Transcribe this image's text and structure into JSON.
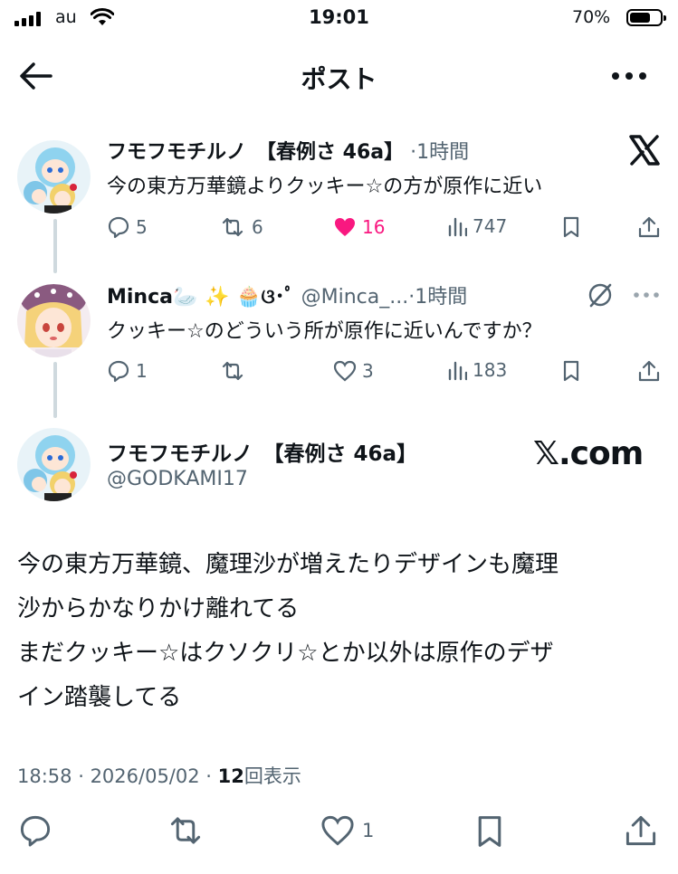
{
  "status_bar": {
    "carrier": "au",
    "time": "19:01",
    "battery_percent": "70%",
    "battery_level": 0.7
  },
  "nav": {
    "title": "ポスト",
    "back_icon": "arrow-left-icon",
    "more_icon": "more-horizontal-icon"
  },
  "thread": [
    {
      "author_name": "フモフモチルノ　【春例さ 46a】",
      "separator": "·",
      "time": "1時間",
      "text": "今の東方万華鏡よりクッキー☆の方が原作に近い",
      "badge_icon": "x-logo-icon",
      "replies": "5",
      "reposts": "6",
      "likes": "16",
      "liked": true,
      "views": "747"
    },
    {
      "author_name": "Minca🦢 ✨ 🧁ଓ･ﾟ",
      "handle": "@Minca_...",
      "separator": "·",
      "time": "1時間",
      "text": "クッキー☆のどういう所が原作に近いんですか？",
      "badge_icon": "grok-icon",
      "replies": "1",
      "reposts": "",
      "likes": "3",
      "liked": false,
      "views": "183"
    }
  ],
  "main_post": {
    "author_name": "フモフモチルノ　【春例さ 46a】",
    "handle": "@GODKAMI17",
    "watermark": "𝕏.com",
    "text_lines": [
      "今の東方万華鏡、魔理沙が増えたりデザインも魔理",
      "沙からかなりかけ離れてる",
      "まだクッキー☆はクソクリ☆とか以外は原作のデザ",
      "イン踏襲してる"
    ],
    "time": "18:58",
    "separator": " · ",
    "date": "2026/05/02",
    "separator2": " · ",
    "views_count": "12",
    "views_label": "回表示",
    "likes": "1"
  },
  "colors": {
    "text": "#0f1419",
    "secondary": "#536471",
    "like": "#f91880",
    "thread_line": "#cfd9de"
  }
}
